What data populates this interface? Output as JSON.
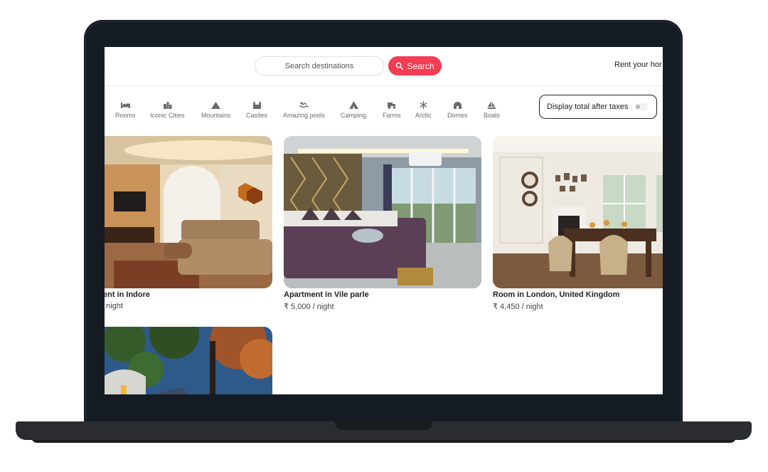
{
  "header": {
    "search_placeholder": "Search destinations",
    "search_button": "Search",
    "rent_link": "Rent your hor"
  },
  "categories": [
    {
      "label": "Rooms",
      "icon": "bed-icon"
    },
    {
      "label": "Iconic Cities",
      "icon": "city-icon"
    },
    {
      "label": "Mountains",
      "icon": "mountain-icon"
    },
    {
      "label": "Castles",
      "icon": "castle-icon"
    },
    {
      "label": "Amazing pools",
      "icon": "pool-icon"
    },
    {
      "label": "Camping",
      "icon": "tent-icon"
    },
    {
      "label": "Farms",
      "icon": "tractor-icon"
    },
    {
      "label": "Arctic",
      "icon": "snowflake-icon"
    },
    {
      "label": "Domes",
      "icon": "dome-icon"
    },
    {
      "label": "Boats",
      "icon": "sailboat-icon"
    }
  ],
  "tax_toggle": {
    "label": "Display total after taxes",
    "enabled": false
  },
  "listings": [
    {
      "title": "ent in Indore",
      "price": "/ night"
    },
    {
      "title": "Apartment in Vile parle",
      "price": "₹ 5,000 / night"
    },
    {
      "title": "Room in London, United Kingdom",
      "price": "₹ 4,450 / night"
    }
  ],
  "colors": {
    "accent": "#f43c52",
    "laptop_frame": "#151b22"
  }
}
